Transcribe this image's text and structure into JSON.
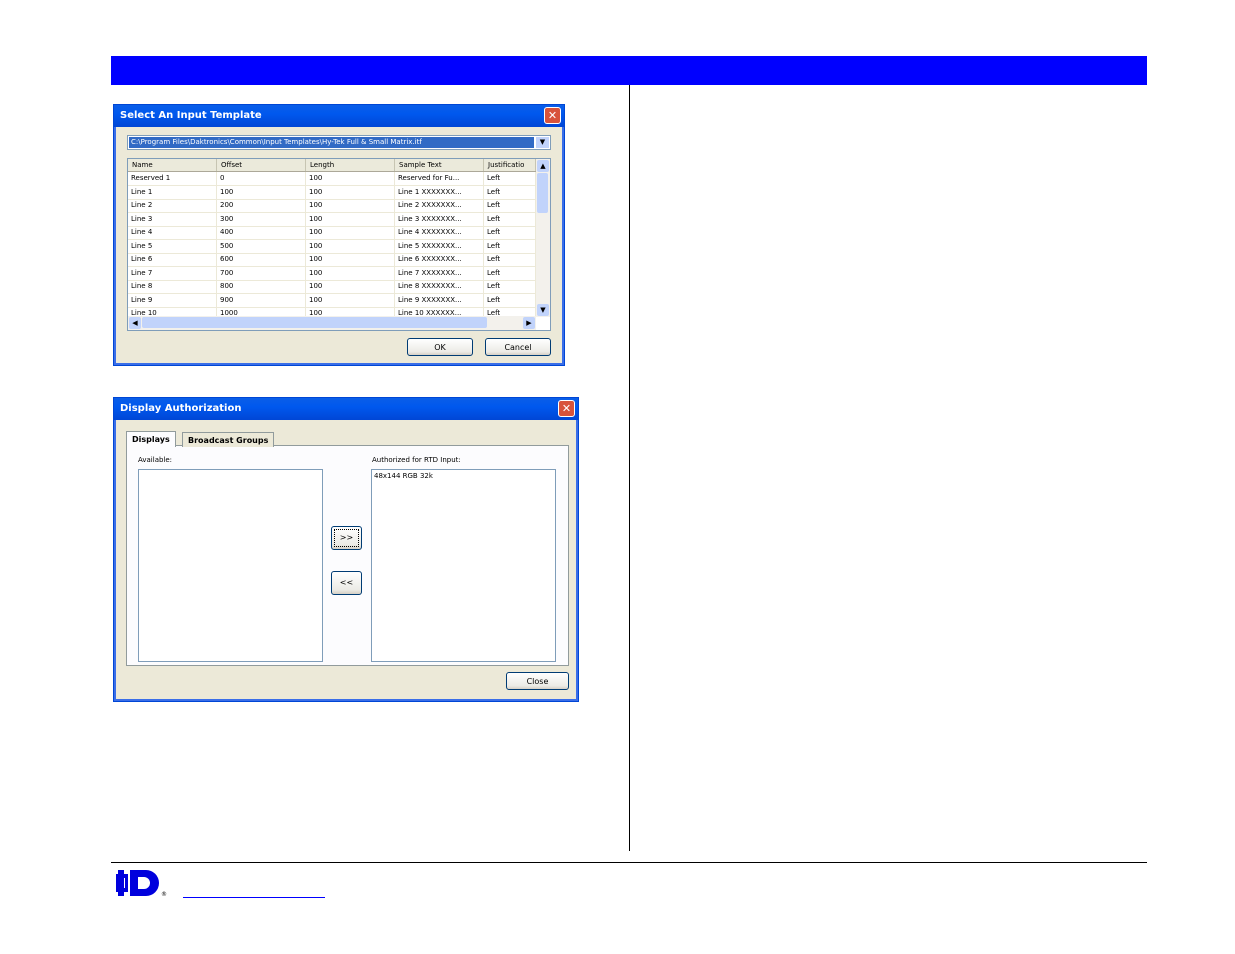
{
  "template_dialog": {
    "title": "Select An Input Template",
    "close_glyph": "✕",
    "path": "C:\\Program Files\\Daktronics\\Common\\Input Templates\\Hy-Tek Full & Small Matrix.itf",
    "combo_arrow": "▼",
    "columns": [
      "Name",
      "Offset",
      "Length",
      "Sample Text",
      "Justificatio"
    ],
    "rows": [
      [
        "Reserved 1",
        "0",
        "100",
        "Reserved for Fu...",
        "Left"
      ],
      [
        "Line 1",
        "100",
        "100",
        "Line 1 XXXXXXX...",
        "Left"
      ],
      [
        "Line 2",
        "200",
        "100",
        "Line 2 XXXXXXX...",
        "Left"
      ],
      [
        "Line 3",
        "300",
        "100",
        "Line 3 XXXXXXX...",
        "Left"
      ],
      [
        "Line 4",
        "400",
        "100",
        "Line 4 XXXXXXX...",
        "Left"
      ],
      [
        "Line 5",
        "500",
        "100",
        "Line 5 XXXXXXX...",
        "Left"
      ],
      [
        "Line 6",
        "600",
        "100",
        "Line 6 XXXXXXX...",
        "Left"
      ],
      [
        "Line 7",
        "700",
        "100",
        "Line 7 XXXXXXX...",
        "Left"
      ],
      [
        "Line 8",
        "800",
        "100",
        "Line 8 XXXXXXX...",
        "Left"
      ],
      [
        "Line 9",
        "900",
        "100",
        "Line 9 XXXXXXX...",
        "Left"
      ],
      [
        "Line 10",
        "1000",
        "100",
        "Line 10 XXXXXX...",
        "Left"
      ]
    ],
    "scroll": {
      "up": "▲",
      "down": "▼",
      "left": "◀",
      "right": "▶"
    },
    "ok_label": "OK",
    "cancel_label": "Cancel"
  },
  "auth_dialog": {
    "title": "Display Authorization",
    "close_glyph": "✕",
    "tabs": [
      "Displays",
      "Broadcast Groups"
    ],
    "available_label": "Available:",
    "authorized_label": "Authorized for RTD Input:",
    "authorized_items": [
      "48x144 RGB 32k"
    ],
    "add_label": ">>",
    "remove_label": "<<",
    "close_label": "Close"
  },
  "colors": {
    "header_bar": "#0000ff",
    "xp_title": "#0058ee",
    "dialog_bg": "#ece9d8"
  }
}
